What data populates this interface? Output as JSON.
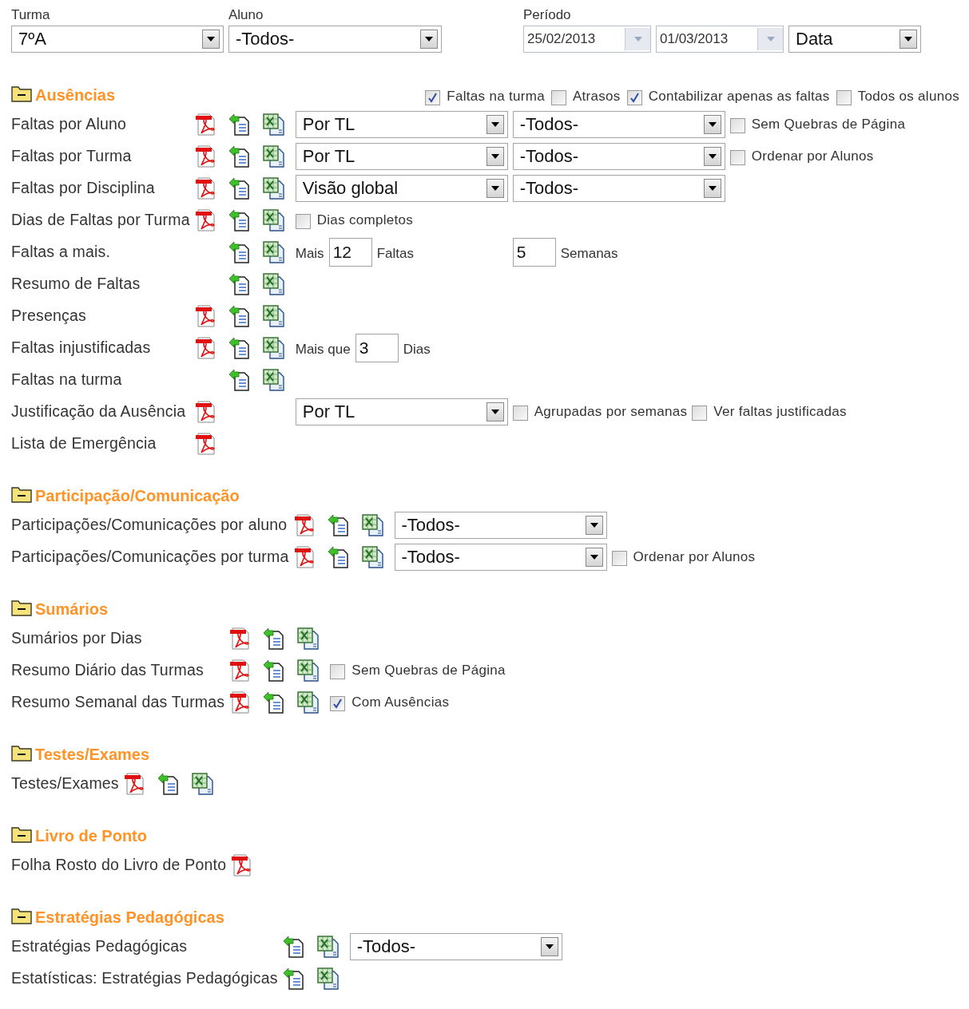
{
  "filters": {
    "turma": {
      "label": "Turma",
      "value": "7ºA"
    },
    "aluno": {
      "label": "Aluno",
      "value": "-Todos-"
    },
    "periodo": {
      "label": "Período",
      "from": "25/02/2013",
      "to": "01/03/2013",
      "mode": "Data"
    }
  },
  "sections": [
    {
      "title": "Ausências",
      "expanded": true,
      "options": [
        {
          "label": "Faltas na turma",
          "checked": true
        },
        {
          "label": "Atrasos",
          "checked": false
        },
        {
          "label": "Contabilizar apenas as faltas",
          "checked": true
        },
        {
          "label": "Todos os alunos",
          "checked": false
        }
      ],
      "rows": [
        {
          "label": "Faltas por Aluno",
          "pdf": true,
          "doc": true,
          "xls": true,
          "controls": [
            [
              {
                "kind": "select",
                "value": "Por TL"
              }
            ],
            [
              {
                "kind": "select",
                "value": "-Todos-"
              }
            ],
            [
              {
                "kind": "checkbox",
                "label": "Sem Quebras de Página",
                "checked": false
              }
            ]
          ]
        },
        {
          "label": "Faltas por Turma",
          "pdf": true,
          "doc": true,
          "xls": true,
          "controls": [
            [
              {
                "kind": "select",
                "value": "Por TL"
              }
            ],
            [
              {
                "kind": "select",
                "value": "-Todos-"
              }
            ],
            [
              {
                "kind": "checkbox",
                "label": "Ordenar por Alunos",
                "checked": false
              }
            ]
          ]
        },
        {
          "label": "Faltas por Disciplina",
          "pdf": true,
          "doc": true,
          "xls": true,
          "controls": [
            [
              {
                "kind": "select",
                "value": "Visão global"
              }
            ],
            [
              {
                "kind": "select",
                "value": "-Todos-"
              }
            ]
          ]
        },
        {
          "label": "Dias de Faltas por Turma",
          "pdf": true,
          "doc": true,
          "xls": true,
          "controls": [
            [
              {
                "kind": "checkbox",
                "label": "Dias completos",
                "checked": false
              }
            ]
          ]
        },
        {
          "label": "Faltas a mais.",
          "pdf": false,
          "doc": true,
          "xls": true,
          "controls": [
            [
              {
                "kind": "text",
                "value": "Mais"
              },
              {
                "kind": "input",
                "value": "12"
              },
              {
                "kind": "text",
                "value": "Faltas"
              }
            ],
            [
              {
                "kind": "input",
                "value": "5"
              },
              {
                "kind": "text",
                "value": "Semanas"
              }
            ]
          ]
        },
        {
          "label": "Resumo de Faltas",
          "pdf": false,
          "doc": true,
          "xls": true
        },
        {
          "label": "Presenças",
          "pdf": true,
          "doc": true,
          "xls": true
        },
        {
          "label": "Faltas injustificadas",
          "pdf": true,
          "doc": true,
          "xls": true,
          "controls": [
            [
              {
                "kind": "text",
                "value": "Mais que"
              },
              {
                "kind": "input",
                "value": "3"
              },
              {
                "kind": "text",
                "value": "Dias"
              }
            ]
          ]
        },
        {
          "label": "Faltas na turma",
          "pdf": false,
          "doc": true,
          "xls": true
        },
        {
          "label": "Justificação da Ausência",
          "pdf": true,
          "doc": false,
          "xls": false,
          "controls": [
            [
              {
                "kind": "select",
                "value": "Por TL"
              }
            ],
            [
              {
                "kind": "checkbox",
                "label": "Agrupadas por semanas",
                "checked": false
              },
              {
                "kind": "checkbox",
                "label": "Ver faltas justificadas",
                "checked": false
              }
            ]
          ]
        },
        {
          "label": "Lista de Emergência",
          "pdf": true,
          "doc": false,
          "xls": false
        }
      ]
    },
    {
      "title": "Participação/Comunicação",
      "expanded": true,
      "rows": [
        {
          "label": "Participações/Comunicações por aluno",
          "pdf": true,
          "doc": true,
          "xls": true,
          "controls": [
            [
              {
                "kind": "select",
                "value": "-Todos-"
              }
            ]
          ]
        },
        {
          "label": "Participações/Comunicações por turma",
          "pdf": true,
          "doc": true,
          "xls": true,
          "controls": [
            [
              {
                "kind": "select",
                "value": "-Todos-"
              }
            ],
            [
              {
                "kind": "checkbox",
                "label": "Ordenar por Alunos",
                "checked": false
              }
            ]
          ]
        }
      ]
    },
    {
      "title": "Sumários",
      "expanded": true,
      "rows": [
        {
          "label": "Sumários por Dias",
          "pdf": true,
          "doc": true,
          "xls": true
        },
        {
          "label": "Resumo Diário das Turmas",
          "pdf": true,
          "doc": true,
          "xls": true,
          "controls": [
            [
              {
                "kind": "checkbox",
                "label": "Sem Quebras de Página",
                "checked": false
              }
            ]
          ]
        },
        {
          "label": "Resumo Semanal das Turmas",
          "pdf": true,
          "doc": true,
          "xls": true,
          "controls": [
            [
              {
                "kind": "checkbox",
                "label": "Com Ausências",
                "checked": true
              }
            ]
          ]
        }
      ]
    },
    {
      "title": "Testes/Exames",
      "expanded": true,
      "rows": [
        {
          "label": "Testes/Exames",
          "pdf": true,
          "doc": true,
          "xls": true
        }
      ]
    },
    {
      "title": "Livro de Ponto",
      "expanded": true,
      "rows": [
        {
          "label": "Folha Rosto do Livro de Ponto",
          "pdf": true,
          "doc": false,
          "xls": false
        }
      ]
    },
    {
      "title": "Estratégias Pedagógicas",
      "expanded": true,
      "rows": [
        {
          "label": "Estratégias Pedagógicas",
          "pdf": false,
          "doc": true,
          "xls": true,
          "controls": [
            [
              {
                "kind": "select",
                "value": "-Todos-"
              }
            ]
          ]
        },
        {
          "label": "Estatísticas: Estratégias Pedagógicas",
          "pdf": false,
          "doc": true,
          "xls": true
        }
      ]
    }
  ]
}
